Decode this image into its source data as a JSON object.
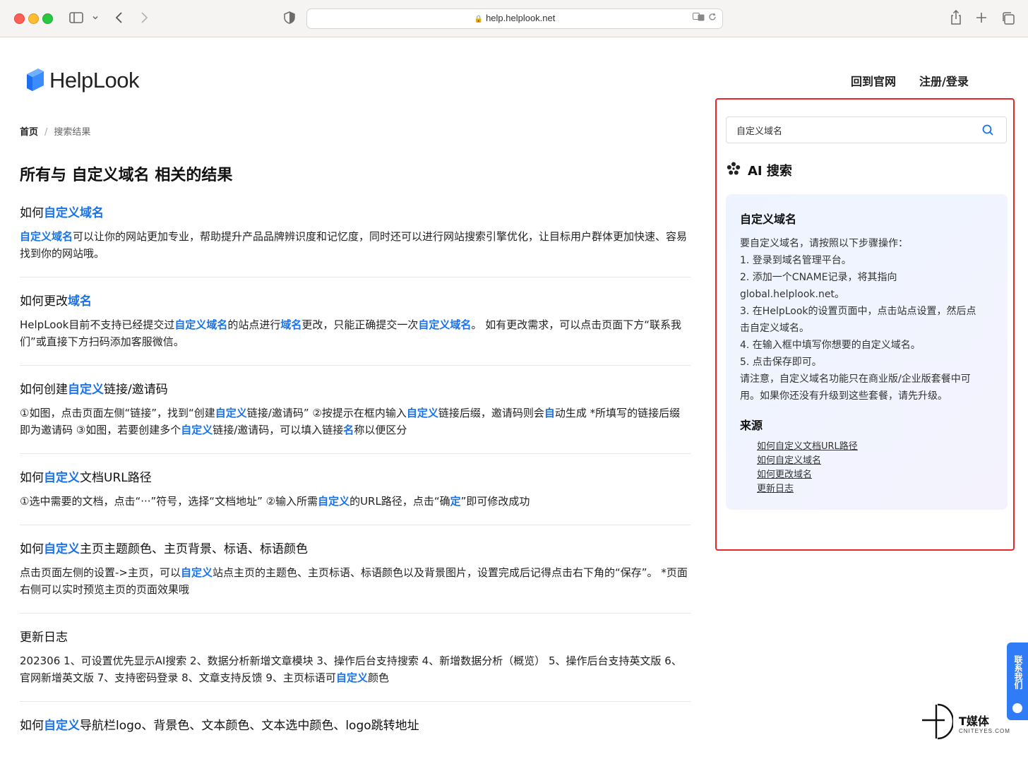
{
  "browser": {
    "url": "help.helplook.net"
  },
  "header": {
    "logo_text": "HelpLook",
    "nav": [
      "回到官网",
      "注册/登录"
    ]
  },
  "breadcrumb": {
    "home": "首页",
    "separator": "/",
    "current": "搜索结果"
  },
  "page_title": "所有与 自定义域名 相关的结果",
  "results": [
    {
      "title": [
        {
          "t": "如何"
        },
        {
          "t": "自定义域名",
          "h": true
        }
      ],
      "body": [
        {
          "t": "自定义域名",
          "h": true
        },
        {
          "t": "可以让你的网站更加专业，帮助提升产品品牌辨识度和记忆度，同时还可以进行网站搜索引擎优化，让目标用户群体更加快速、容易找到你的网站哦。"
        }
      ]
    },
    {
      "title": [
        {
          "t": "如何更改"
        },
        {
          "t": "域名",
          "h": true
        }
      ],
      "body": [
        {
          "t": "HelpLook目前不支持已经提交过"
        },
        {
          "t": "自定义域名",
          "h": true
        },
        {
          "t": "的站点进行"
        },
        {
          "t": "域名",
          "h": true
        },
        {
          "t": "更改，只能正确提交一次"
        },
        {
          "t": "自定义域名",
          "h": true
        },
        {
          "t": "。 如有更改需求，可以点击页面下方“联系我们”或直接下方扫码添加客服微信。"
        }
      ]
    },
    {
      "title": [
        {
          "t": "如何创建"
        },
        {
          "t": "自定义",
          "h": true
        },
        {
          "t": "链接/邀请码"
        }
      ],
      "body": [
        {
          "t": "①如图，点击页面左侧“链接”，找到“创建"
        },
        {
          "t": "自定义",
          "h": true
        },
        {
          "t": "链接/邀请码” ②按提示在框内输入"
        },
        {
          "t": "自定义",
          "h": true
        },
        {
          "t": "链接后缀，邀请码则会"
        },
        {
          "t": "自",
          "h": true
        },
        {
          "t": "动生成 *所填写的链接后缀即为邀请码 ③如图，若要创建多个"
        },
        {
          "t": "自定义",
          "h": true
        },
        {
          "t": "链接/邀请码，可以填入链接"
        },
        {
          "t": "名",
          "h": true
        },
        {
          "t": "称以便区分"
        }
      ]
    },
    {
      "title": [
        {
          "t": "如何"
        },
        {
          "t": "自定义",
          "h": true
        },
        {
          "t": "文档URL路径"
        }
      ],
      "body": [
        {
          "t": "①选中需要的文档，点击“···”符号，选择“文档地址” ②输入所需"
        },
        {
          "t": "自定义",
          "h": true
        },
        {
          "t": "的URL路径，点击“确"
        },
        {
          "t": "定",
          "h": true
        },
        {
          "t": "”即可修改成功"
        }
      ]
    },
    {
      "title": [
        {
          "t": "如何"
        },
        {
          "t": "自定义",
          "h": true
        },
        {
          "t": "主页主题颜色、主页背景、标语、标语颜色"
        }
      ],
      "body": [
        {
          "t": "点击页面左侧的设置->主页，可以"
        },
        {
          "t": "自定义",
          "h": true
        },
        {
          "t": "站点主页的主题色、主页标语、标语颜色以及背景图片，设置完成后记得点击右下角的“保存”。 *页面右侧可以实时预览主页的页面效果哦"
        }
      ]
    },
    {
      "title": [
        {
          "t": "更新日志"
        }
      ],
      "body": [
        {
          "t": "202306 1、可设置优先显示AI搜索 2、数据分析新增文章模块 3、操作后台支持搜索 4、新增数据分析（概览） 5、操作后台支持英文版 6、官网新增英文版 7、支持密码登录 8、文章支持反馈 9、主页标语可"
        },
        {
          "t": "自定义",
          "h": true
        },
        {
          "t": "颜色"
        }
      ]
    },
    {
      "title": [
        {
          "t": "如何"
        },
        {
          "t": "自定义",
          "h": true
        },
        {
          "t": "导航栏logo、背景色、文本颜色、文本选中颜色、logo跳转地址"
        }
      ],
      "body": []
    }
  ],
  "search": {
    "value": "自定义域名"
  },
  "ai": {
    "heading": "AI 搜索",
    "card_title": "自定义域名",
    "lines": [
      "要自定义域名，请按照以下步骤操作：",
      "1. 登录到域名管理平台。",
      "2. 添加一个CNAME记录，将其指向",
      "global.helplook.net。",
      "3. 在HelpLook的设置页面中，点击站点设置，然后点",
      "击自定义域名。",
      "4. 在输入框中填写你想要的自定义域名。",
      "5. 点击保存即可。",
      "请注意，自定义域名功能只在商业版/企业版套餐中可",
      "用。如果你还没有升级到这些套餐，请先升级。"
    ],
    "sources_title": "来源",
    "sources": [
      "如何自定义文档URL路径",
      "如何自定义域名",
      "如何更改域名",
      "更新日志"
    ]
  },
  "contact": {
    "label": "联系我们"
  },
  "watermark": {
    "name": "T媒体",
    "site": "CNITEYES.COM"
  },
  "colors": {
    "highlight": "#1a73e8",
    "panel_border": "#e8262a",
    "contact_tab": "#2f7cf6"
  }
}
